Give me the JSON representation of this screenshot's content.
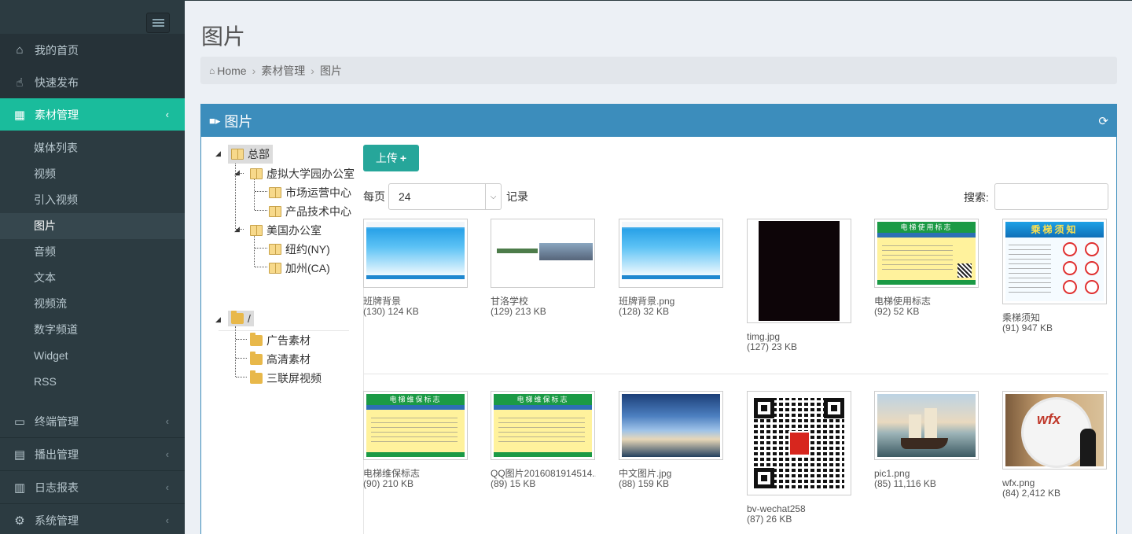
{
  "sidebar": {
    "menu": [
      {
        "label": "我的首页",
        "icon": "home-icon"
      },
      {
        "label": "快速发布",
        "icon": "hand-pointer-icon"
      },
      {
        "label": "素材管理",
        "icon": "qrcode-icon"
      }
    ],
    "submenu": [
      "媒体列表",
      "视频",
      "引入视频",
      "图片",
      "音频",
      "文本",
      "视频流",
      "数字频道",
      "Widget",
      "RSS"
    ],
    "menu_bottom": [
      {
        "label": "终端管理",
        "icon": "desktop-icon"
      },
      {
        "label": "播出管理",
        "icon": "calendar-icon"
      },
      {
        "label": "日志报表",
        "icon": "bar-chart-icon"
      },
      {
        "label": "系统管理",
        "icon": "cogs-icon"
      }
    ],
    "active_color": "#1abc9c"
  },
  "page": {
    "title": "图片",
    "breadcrumb": [
      "Home",
      "素材管理",
      "图片"
    ]
  },
  "panel": {
    "title": "图片",
    "header_color": "#3c8dbc"
  },
  "tree": {
    "root": "总部",
    "n1": "虚拟大学园办公室",
    "n1a": "市场运营中心",
    "n1b": "产品技术中心",
    "n2": "美国办公室",
    "n2a": "纽约(NY)",
    "n2b": "加州(CA)",
    "root2": "/",
    "f1": "广告素材",
    "f2": "高清素材",
    "f3": "三联屏视频"
  },
  "controls": {
    "upload": "上传",
    "perpage_label": "每页",
    "perpage_value": "24",
    "records_label": "记录",
    "search_label": "搜索:"
  },
  "files": [
    {
      "name": "班牌背景",
      "meta": "(130) 124 KB"
    },
    {
      "name": "甘洛学校",
      "meta": "(129) 213 KB"
    },
    {
      "name": "班牌背景.png",
      "meta": "(128) 32 KB"
    },
    {
      "name": "timg.jpg",
      "meta": "(127) 23 KB"
    },
    {
      "name": "电梯使用标志",
      "meta": "(92) 52 KB"
    },
    {
      "name": "乘梯须知",
      "meta": "(91) 947 KB"
    },
    {
      "name": "电梯维保标志",
      "meta": "(90) 210 KB"
    },
    {
      "name": "QQ图片2016081914514...",
      "meta": "(89) 15 KB"
    },
    {
      "name": "中文图片.jpg",
      "meta": "(88) 159 KB"
    },
    {
      "name": "bv-wechat258",
      "meta": "(87) 26 KB"
    },
    {
      "name": "pic1.png",
      "meta": "(85) 11,116 KB"
    },
    {
      "name": "wfx.png",
      "meta": "(84) 2,412 KB"
    }
  ],
  "thumb_text": {
    "sign_use": "电梯使用标志",
    "sign_maint": "电梯维保标志",
    "notice": "乘梯须知",
    "wfx": "wfx"
  }
}
